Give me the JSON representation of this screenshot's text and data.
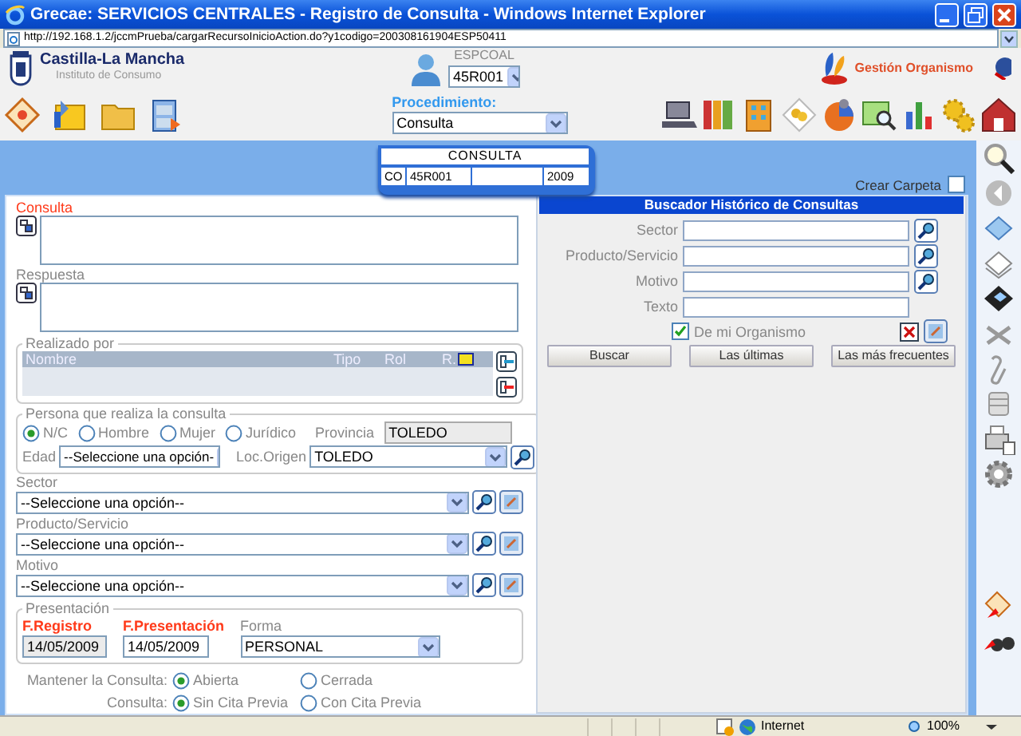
{
  "window": {
    "title": "Grecae: SERVICIOS CENTRALES - Registro de Consulta - Windows Internet Explorer"
  },
  "address_bar": {
    "url": "http://192.168.1.2/jccmPrueba/cargarRecursoInicioAction.do?y1codigo=200308161904ESP50411"
  },
  "header": {
    "org_name": "Castilla-La Mancha",
    "org_subtitle": "Instituto de Consumo",
    "user": "ESPCOAL",
    "office": "45R001",
    "gestion_link": "Gestión Organismo"
  },
  "toolbar": {
    "procedimiento_label": "Procedimiento:",
    "procedimiento": "Consulta"
  },
  "record": {
    "title": "CONSULTA",
    "type_code": "CO",
    "office": "45R001",
    "year": "2009"
  },
  "crear_carpeta": {
    "label": "Crear Carpeta",
    "checked": false
  },
  "text_fields": [
    {
      "label": "Consulta",
      "required": true
    },
    {
      "label": "Respuesta",
      "required": false
    }
  ],
  "realizado_por": {
    "legend": "Realizado por",
    "columns": [
      "Nombre",
      "Tipo",
      "Rol",
      "R."
    ]
  },
  "persona": {
    "legend": "Persona que realiza la consulta",
    "sex_options": [
      {
        "label": "N/C",
        "selected": true
      },
      {
        "label": "Hombre",
        "selected": false
      },
      {
        "label": "Mujer",
        "selected": false
      },
      {
        "label": "Jurídico",
        "selected": false
      }
    ],
    "provincia_label": "Provincia",
    "provincia": "TOLEDO",
    "edad_label": "Edad",
    "edad": "--Seleccione una opción-",
    "loc_label": "Loc.Origen",
    "loc": "TOLEDO"
  },
  "classification": [
    {
      "label": "Sector",
      "value": "--Seleccione una opción--"
    },
    {
      "label": "Producto/Servicio",
      "value": "--Seleccione una opción--"
    },
    {
      "label": "Motivo",
      "value": "--Seleccione una opción--"
    }
  ],
  "presentacion": {
    "legend": "Presentación",
    "fields": [
      {
        "kind": "readonly",
        "label": "F.Registro",
        "value": "14/05/2009",
        "required": true
      },
      {
        "kind": "input",
        "label": "F.Presentación",
        "value": "14/05/2009",
        "required": true
      },
      {
        "kind": "select",
        "label": "Forma",
        "value": "PERSONAL",
        "required": false
      }
    ]
  },
  "radio_groups": [
    {
      "label": "Mantener la Consulta:",
      "options": [
        {
          "label": "Abierta",
          "selected": true
        },
        {
          "label": "Cerrada",
          "selected": false
        }
      ]
    },
    {
      "label": "Consulta:",
      "options": [
        {
          "label": "Sin Cita Previa",
          "selected": true
        },
        {
          "label": "Con Cita Previa",
          "selected": false
        }
      ]
    }
  ],
  "search": {
    "title": "Buscador Histórico de Consultas",
    "fields": [
      {
        "label": "Sector",
        "lookup": true
      },
      {
        "label": "Producto/Servicio",
        "lookup": true
      },
      {
        "label": "Motivo",
        "lookup": true
      },
      {
        "label": "Texto",
        "lookup": false
      }
    ],
    "own_org": {
      "label": "De mi Organismo",
      "checked": true
    },
    "buttons": [
      "Buscar",
      "Las últimas",
      "Las más frecuentes"
    ]
  },
  "status_bar": {
    "zone": "Internet",
    "zoom": "100%"
  }
}
